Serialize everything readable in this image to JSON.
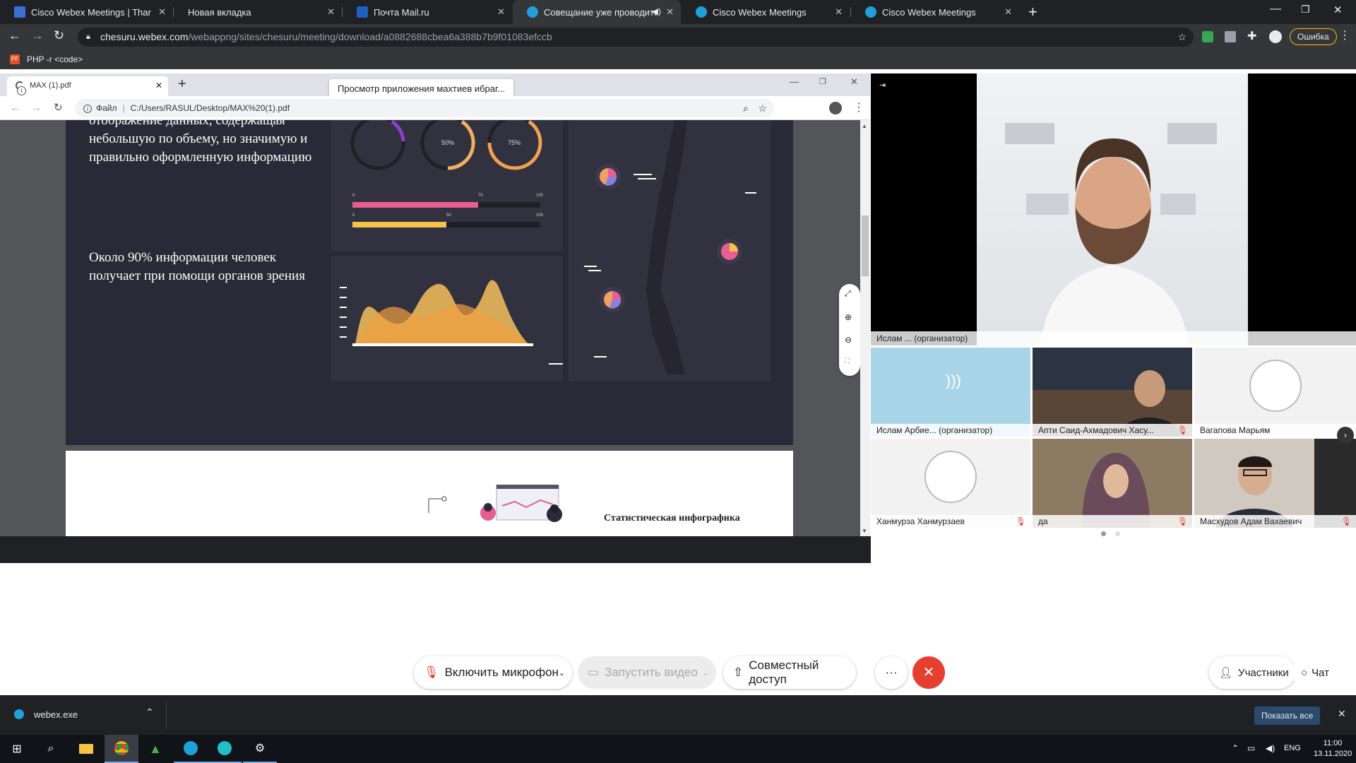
{
  "browser": {
    "tabs": [
      {
        "title": "Cisco Webex Meetings | Thank yo",
        "color": "#3b6fd1"
      },
      {
        "title": "Новая вкладка",
        "color": "#35363a"
      },
      {
        "title": "Почта Mail.ru",
        "color": "#1f5fbf"
      },
      {
        "title": "Совещание уже проводитс",
        "color": "#1fa0d8",
        "active": true
      },
      {
        "title": "Cisco Webex Meetings",
        "color": "#1fa0d8"
      },
      {
        "title": "Cisco Webex Meetings",
        "color": "#1fa0d8"
      }
    ],
    "url_host": "chesuru.webex.com",
    "url_path": "/webappng/sites/chesuru/meeting/download/a0882688cbea6a388b7b9f01083efccb",
    "error_label": "Ошибка",
    "bookmark": "PHP -r <code>"
  },
  "inner_browser": {
    "tab_title": "MAX (1).pdf",
    "tooltip": "Просмотр приложения махтиев ибраг...",
    "file_label": "Файл",
    "path": "C:/Users/RASUL/Desktop/MAX%20(1).pdf"
  },
  "pdf": {
    "text1": "отображение данных, содержащая небольшую по объему, но значимую и правильно оформленную информацию",
    "text2": "Около 90% информации человек получает при помощи органов зрения",
    "gauge1": "50%",
    "gauge2": "75%",
    "bar1_max": "100",
    "bar1_mark": "70",
    "bar2_max": "100",
    "bar2_mark": "50",
    "bar_zero": "0",
    "page2_title": "Статистическая инфографика"
  },
  "video": {
    "host_name": "Ислам ... (организатор)",
    "participants": [
      {
        "name": "Ислам Арбие... (организатор)"
      },
      {
        "name": "Апти Саид-Ахмадович Хасу..."
      },
      {
        "name": "Вагапова Марьям"
      },
      {
        "name": "Ханмурза Ханмурзаев"
      },
      {
        "name": "да"
      },
      {
        "name": "Масхудов Адам Вахаевич"
      }
    ]
  },
  "controls": {
    "mic": "Включить микрофон",
    "video": "Запустить видео",
    "share": "Совместный доступ",
    "more": "···",
    "participants": "Участники",
    "chat": "Чат"
  },
  "download": {
    "file": "webex.exe",
    "show_all": "Показать все"
  },
  "taskbar": {
    "lang": "ENG",
    "time": "11:00",
    "date": "13.11.2020"
  }
}
